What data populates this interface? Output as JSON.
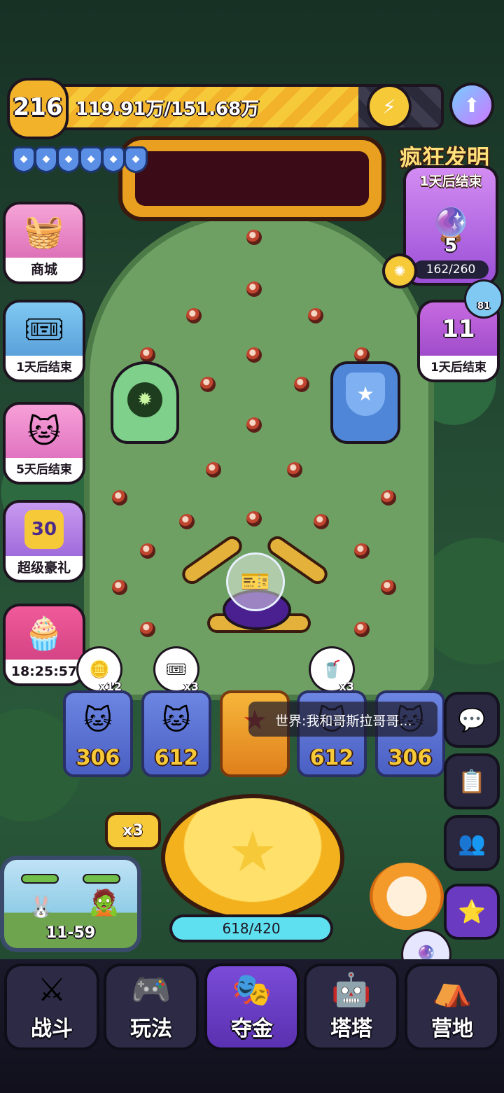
{
  "top_bar": {
    "level": "216",
    "exp_text": "119.91万/151.68万",
    "exp_progress": 0.79
  },
  "shields": {
    "count": 6
  },
  "crazy_invention": {
    "title": "疯狂发明",
    "timer": "1天后结束",
    "count": "5",
    "progress": "162/260"
  },
  "left_side": [
    {
      "label": "商城",
      "icon": "basket-icon"
    },
    {
      "label": "1天后结束",
      "icon": "ticket-icon"
    },
    {
      "label": "5天后结束",
      "icon": "cat-gold-icon"
    },
    {
      "label": "超级豪礼",
      "icon": "gift-30-icon",
      "badge": "30"
    },
    {
      "label": "18:25:57",
      "icon": "cake-icon"
    }
  ],
  "right_event": {
    "label": "1天后结束",
    "number": "11",
    "badge": "81"
  },
  "reward_slots": [
    {
      "value": "306",
      "bubble": "x12"
    },
    {
      "value": "612",
      "bubble": "x3"
    },
    {
      "value": "",
      "bubble": ""
    },
    {
      "value": "612",
      "bubble": "x3"
    },
    {
      "value": "306",
      "bubble": ""
    }
  ],
  "chat": {
    "text": "世界:我和哥斯拉哥哥..."
  },
  "multiplier": "x3",
  "coin_progress": "618/420",
  "stage": {
    "label": "11-59"
  },
  "bottom_nav": [
    {
      "label": "战斗",
      "icon": "swords-icon"
    },
    {
      "label": "玩法",
      "icon": "gamepad-icon"
    },
    {
      "label": "夺金",
      "icon": "faces-icon",
      "active": true
    },
    {
      "label": "塔塔",
      "icon": "robot-cat-icon"
    },
    {
      "label": "营地",
      "icon": "tent-icon"
    }
  ]
}
